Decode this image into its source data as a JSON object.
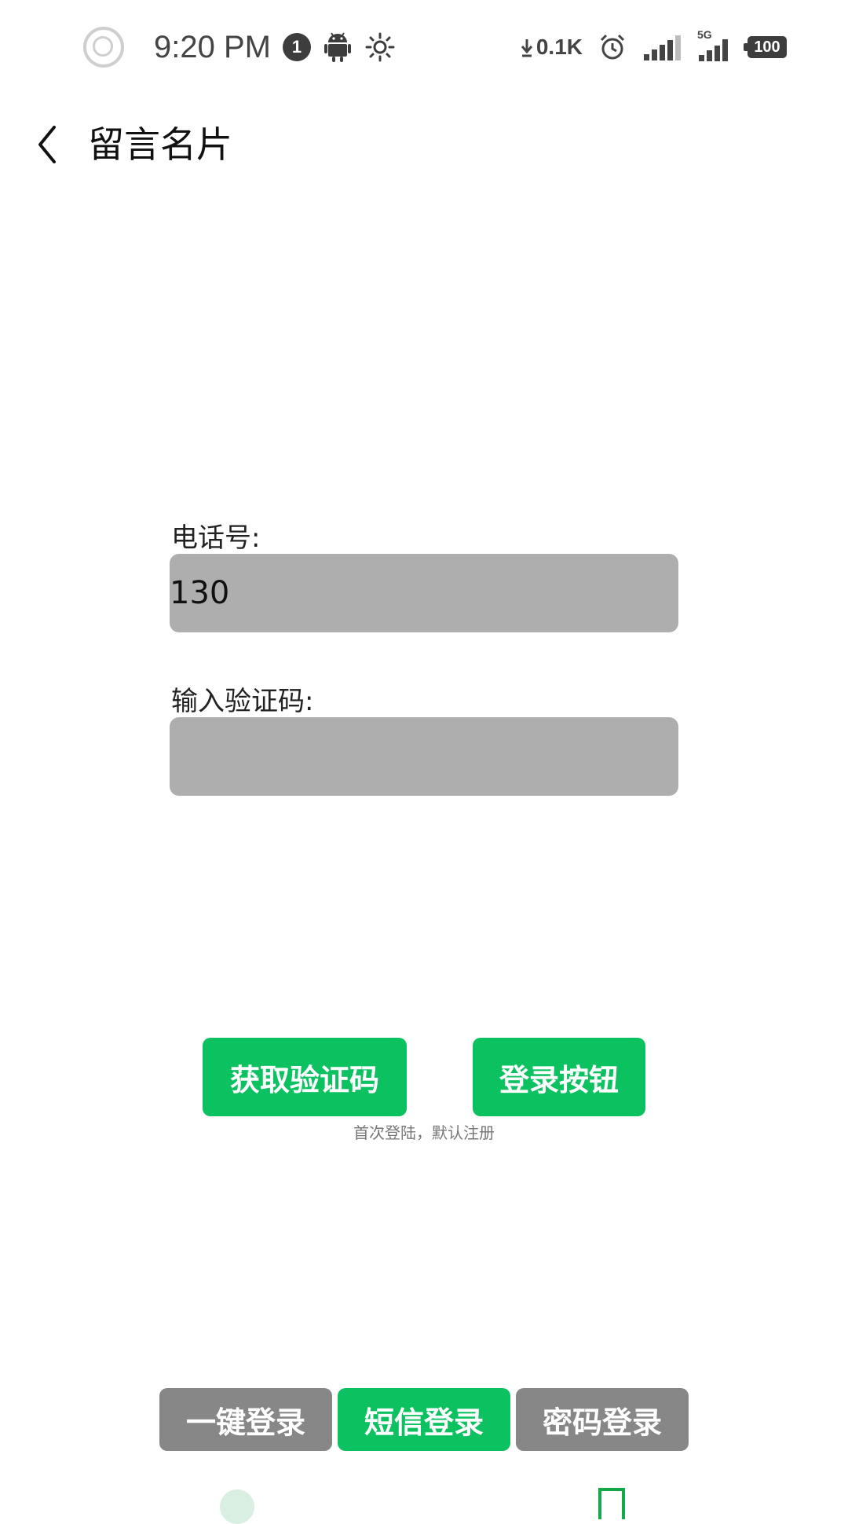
{
  "status_bar": {
    "time": "9:20 PM",
    "notification_count": "1",
    "net_speed": "0.1K",
    "network_type": "5G",
    "battery_level": "100"
  },
  "header": {
    "title": "留言名片"
  },
  "form": {
    "phone_label": "电话号:",
    "phone_value": "130",
    "code_label": "输入验证码:",
    "code_value": ""
  },
  "actions": {
    "get_code_label": "获取验证码",
    "login_label": "登录按钮",
    "hint": "首次登陆，默认注册"
  },
  "login_modes": [
    {
      "label": "一键登录",
      "active": false
    },
    {
      "label": "短信登录",
      "active": true
    },
    {
      "label": "密码登录",
      "active": false
    }
  ],
  "colors": {
    "accent_green": "#0bc160",
    "inactive_gray": "#878787",
    "input_gray": "#afaeae"
  },
  "icons": {
    "back": "chevron-left-icon",
    "notification": "notification-badge-icon",
    "android": "android-icon",
    "brightness": "brightness-icon",
    "download": "download-arrow-icon",
    "alarm": "alarm-clock-icon",
    "signal": "signal-bars-icon",
    "battery": "battery-icon"
  }
}
